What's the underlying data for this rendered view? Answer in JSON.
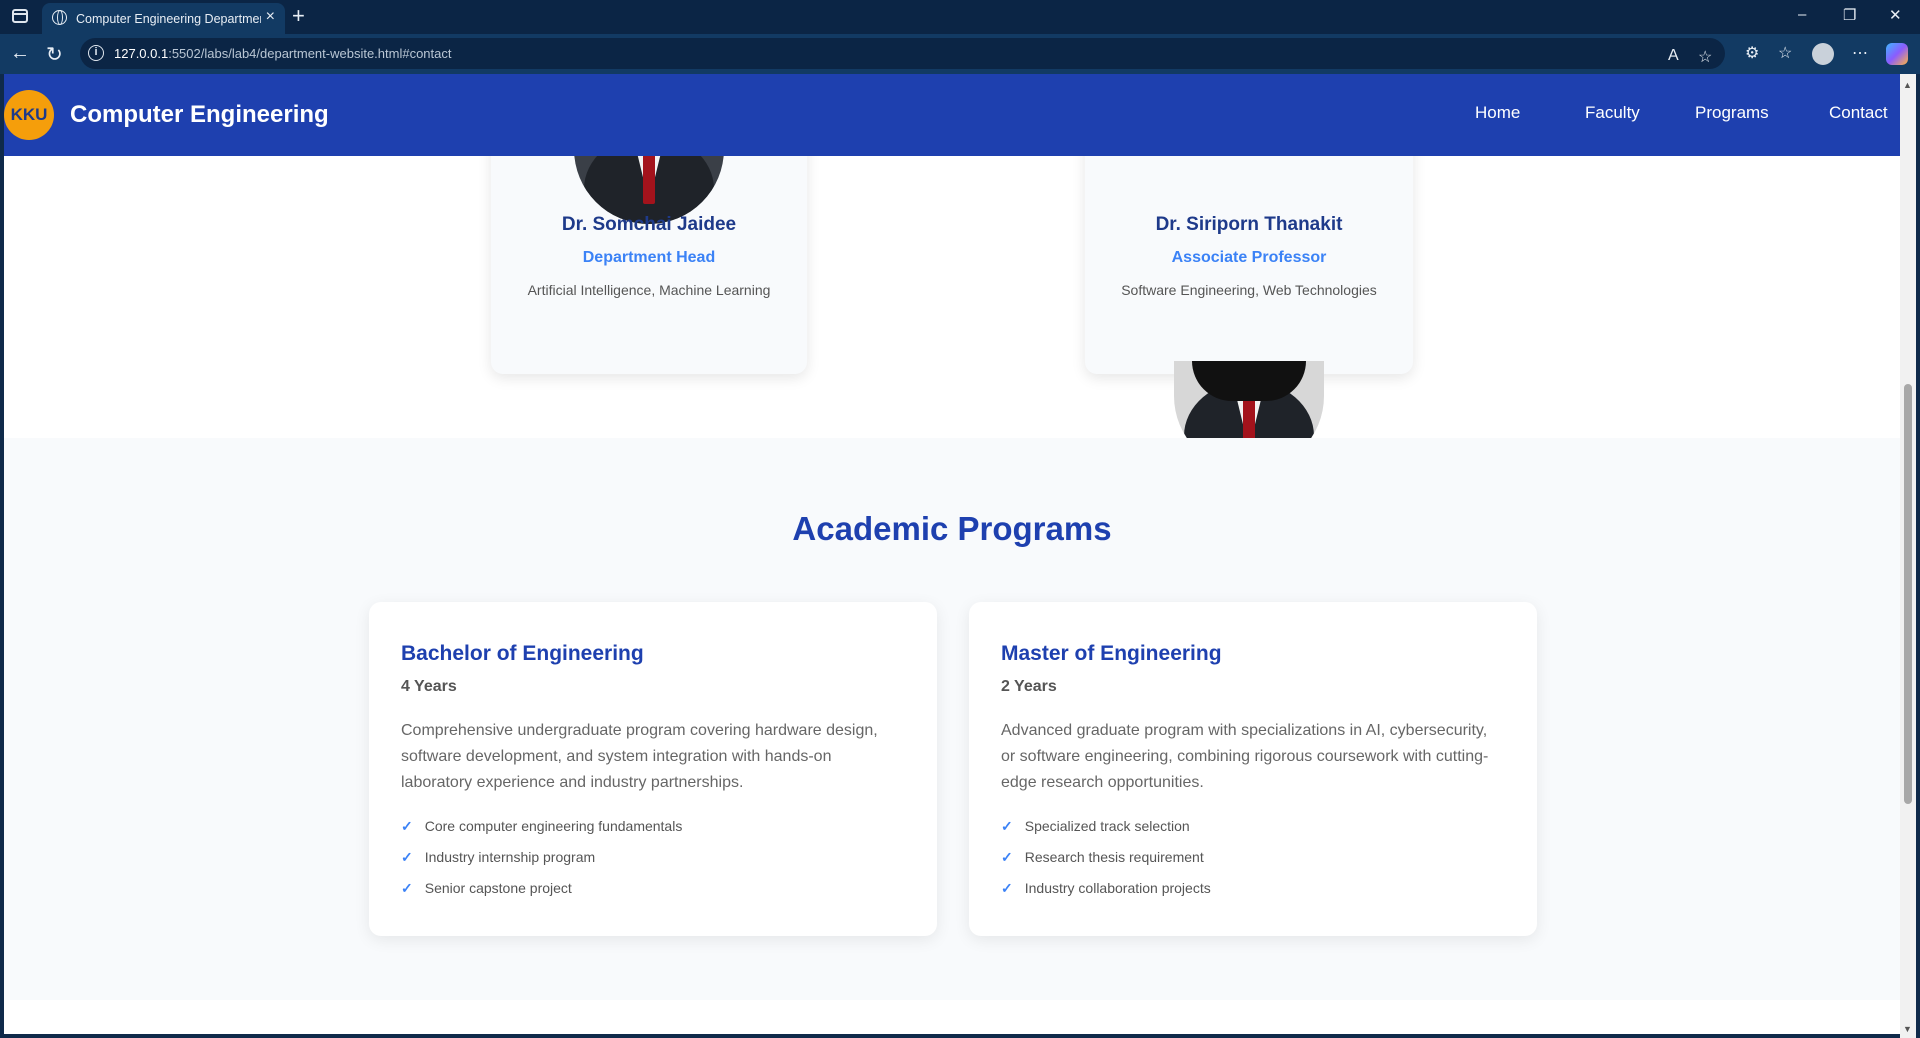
{
  "browser": {
    "tab_title": "Computer Engineering Department",
    "url_host": "127.0.0.1",
    "url_rest": ":5502/labs/lab4/department-website.html#contact"
  },
  "site": {
    "logo_text": "KKU",
    "title": "Computer Engineering",
    "nav": [
      "Home",
      "Faculty",
      "Programs",
      "Contact"
    ]
  },
  "faculty": [
    {
      "name": "Dr. Somchai Jaidee",
      "role": "Department Head",
      "specialty": "Artificial Intelligence, Machine Learning"
    },
    {
      "name": "Dr. Siriporn Thanakit",
      "role": "Associate Professor",
      "specialty": "Software Engineering, Web Technologies"
    }
  ],
  "programs": {
    "heading": "Academic Programs",
    "items": [
      {
        "title": "Bachelor of Engineering",
        "duration": "4 Years",
        "description": "Comprehensive undergraduate program covering hardware design, software development, and system integration with hands-on laboratory experience and industry partnerships.",
        "features": [
          "Core computer engineering fundamentals",
          "Industry internship program",
          "Senior capstone project"
        ]
      },
      {
        "title": "Master of Engineering",
        "duration": "2 Years",
        "description": "Advanced graduate program with specializations in AI, cybersecurity, or software engineering, combining rigorous coursework with cutting-edge research opportunities.",
        "features": [
          "Specialized track selection",
          "Research thesis requirement",
          "Industry collaboration projects"
        ]
      }
    ]
  },
  "colors": {
    "header": "#1e40af",
    "logo": "#f59e0b",
    "accent": "#3b82f6"
  }
}
